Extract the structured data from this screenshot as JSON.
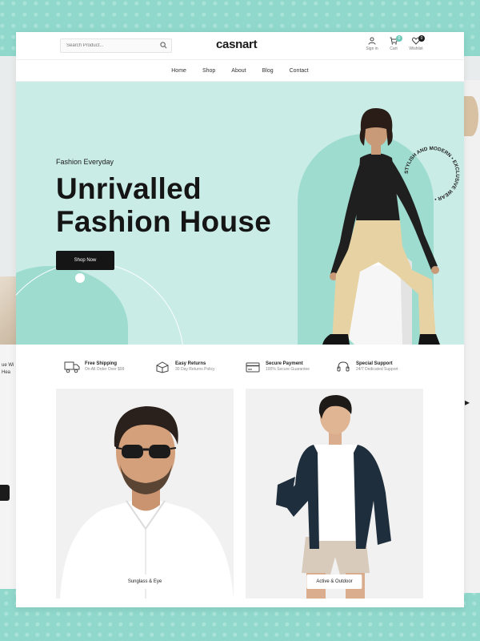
{
  "header": {
    "search_placeholder": "Search Product...",
    "logo": "casnart",
    "actions": [
      {
        "label": "Sign in",
        "icon": "user-icon"
      },
      {
        "label": "Cart",
        "icon": "cart-icon",
        "badge": "0"
      },
      {
        "label": "Wishlist",
        "icon": "heart-icon",
        "badge": "0"
      }
    ]
  },
  "nav": {
    "items": [
      "Home",
      "Shop",
      "About",
      "Blog",
      "Contact"
    ]
  },
  "hero": {
    "eyebrow": "Fashion Everyday",
    "headline_line1": "Unrivalled",
    "headline_line2": "Fashion House",
    "cta": "Shop Now",
    "ring_text": "STYLISH AND MODERN • EXCLUSIVE WEAR •"
  },
  "features": [
    {
      "title": "Free Shipping",
      "subtitle": "On All Order Over $99",
      "icon": "truck-icon"
    },
    {
      "title": "Easy Returns",
      "subtitle": "30 Day Returns Policy",
      "icon": "box-return-icon"
    },
    {
      "title": "Secure Payment",
      "subtitle": "100% Secure Guarantee",
      "icon": "card-icon"
    },
    {
      "title": "Special Support",
      "subtitle": "24/7 Dedicated Support",
      "icon": "headset-icon"
    }
  ],
  "categories": [
    {
      "label": "Sunglass & Eye"
    },
    {
      "label": "Active & Outdoor"
    }
  ],
  "peek_left_text": "ue Wi Hea",
  "colors": {
    "brand_teal": "#8fd8cb",
    "hero_bg": "#c9ece7",
    "dark": "#151515"
  }
}
